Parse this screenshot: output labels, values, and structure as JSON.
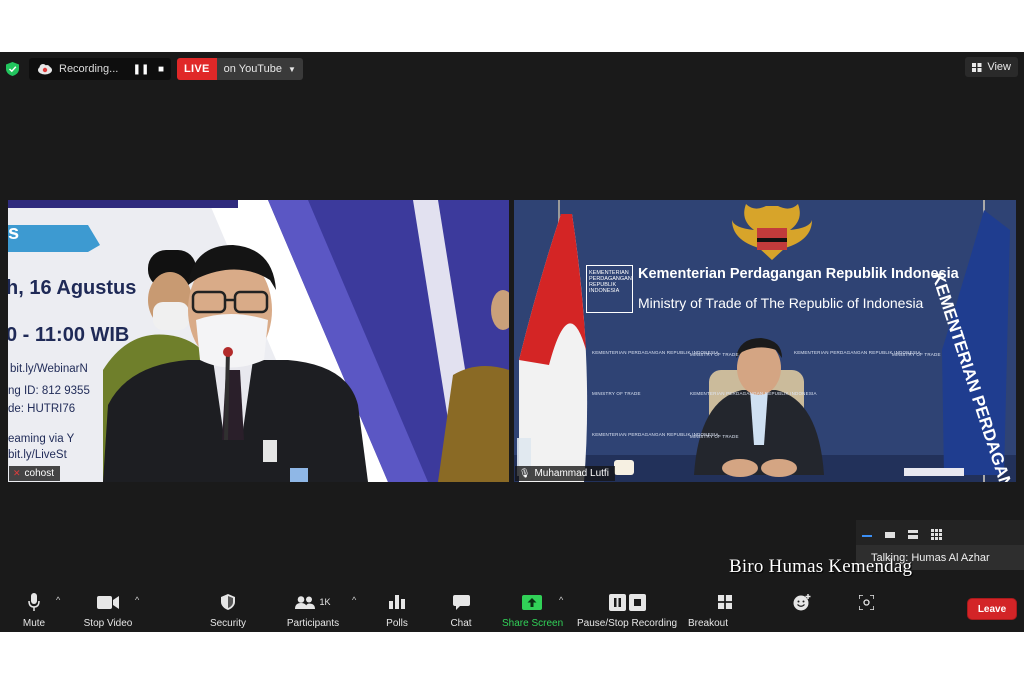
{
  "topbar": {
    "recording_label": "Recording...",
    "live_label": "LIVE",
    "live_target": "on YouTube",
    "view_label": "View"
  },
  "videos": {
    "left": {
      "name": "cohost",
      "slide_lines": [
        "s",
        "h, 16 Agustus",
        "0 - 11:00 WIB",
        "bit.ly/WebinarN",
        "ng ID: 812 9355",
        "de: HUTRI76",
        "eaming via Y",
        "bit.ly/LiveSt"
      ]
    },
    "right": {
      "name": "Muhammad Lutfi",
      "banner_id": "Kementerian Perdagangan Republik Indonesia",
      "banner_en": "Ministry of Trade of The Republic of Indonesia",
      "logo_text": "KEMENTERIAN PERDAGANGAN REPUBLIK INDONESIA",
      "flag_text": "KEMENTERIAN PERDAGANGAN REPUBLIK INDONESIA",
      "bg_text_1": "KEMENTERIAN PERDAGANGAN REPUBLIK INDONESIA",
      "bg_text_2": "MINISTRY OF TRADE"
    }
  },
  "talking": {
    "text": "Talking: Humas Al Azhar"
  },
  "toolbar": {
    "mute": "Mute",
    "stop_video": "Stop Video",
    "security": "Security",
    "participants": "Participants",
    "participants_count": "1K",
    "polls": "Polls",
    "chat": "Chat",
    "share_screen": "Share Screen",
    "pause_stop_recording": "Pause/Stop Recording",
    "breakout": "Breakout",
    "leave": "Leave"
  },
  "watermark": "Biro Humas Kemendag",
  "colors": {
    "live_red": "#e02828",
    "share_green": "#31d158",
    "leave_red": "#d32427",
    "shield_green": "#22c55e"
  }
}
